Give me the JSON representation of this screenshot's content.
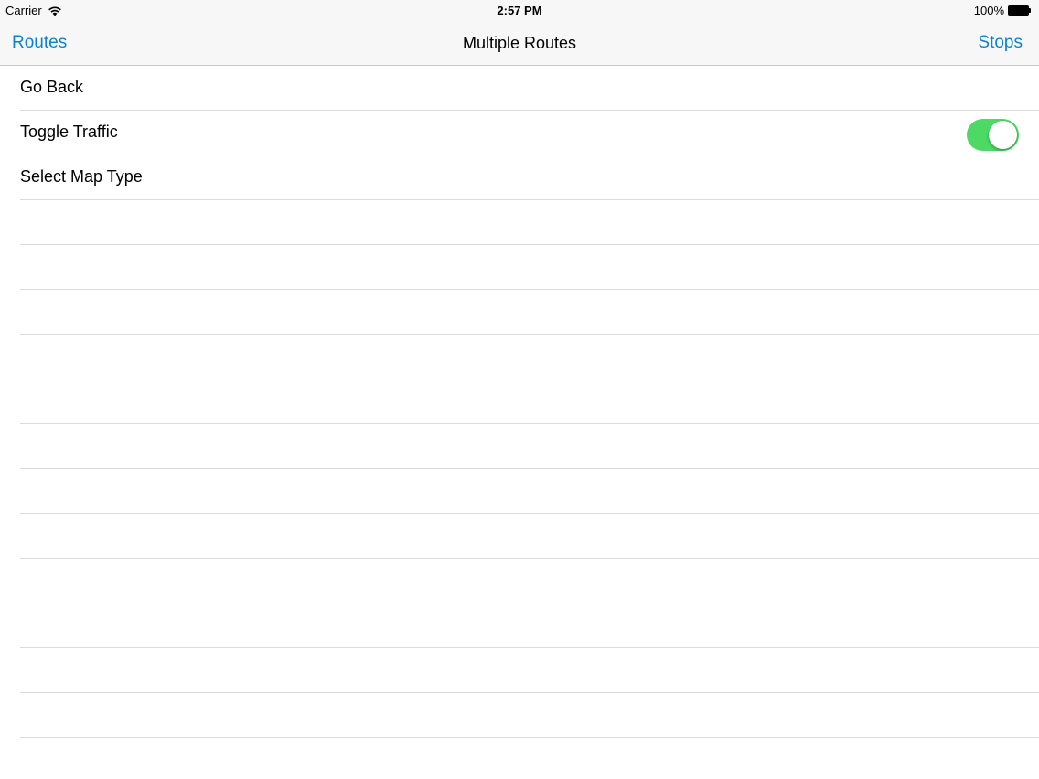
{
  "status_bar": {
    "carrier": "Carrier",
    "wifi_icon": "wifi-icon",
    "time": "2:57 PM",
    "battery_percent": "100%",
    "battery_icon": "battery-icon"
  },
  "nav_bar": {
    "left_button": "Routes",
    "title": "Multiple Routes",
    "right_button": "Stops",
    "accent_color": "#0a84d0"
  },
  "table": {
    "rows": [
      {
        "label": "Go Back"
      },
      {
        "label": "Toggle Traffic",
        "toggle_on": true,
        "toggle_color": "#4cd964"
      },
      {
        "label": "Select Map Type"
      }
    ]
  }
}
